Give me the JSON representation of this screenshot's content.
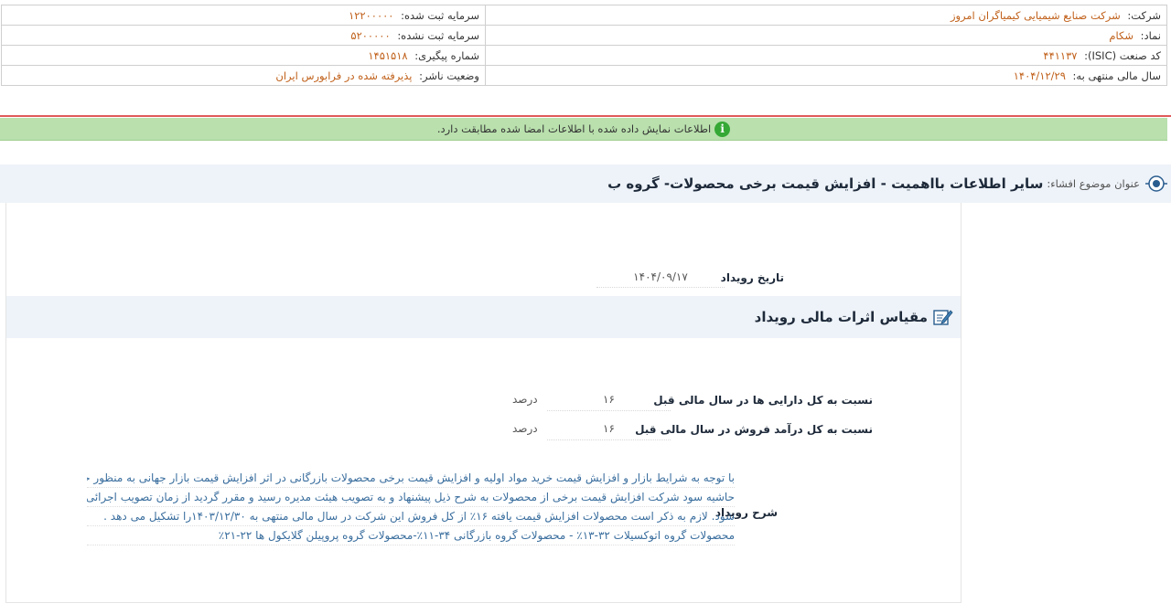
{
  "header": {
    "company_label": "شرکت:",
    "company_value": "شرکت صنایع شیمیایی کیمیاگران امروز",
    "registered_capital_label": "سرمایه ثبت شده:",
    "registered_capital_value": "۱۲۲۰۰۰۰۰",
    "symbol_label": "نماد:",
    "symbol_value": "شکام",
    "unregistered_capital_label": "سرمایه ثبت نشده:",
    "unregistered_capital_value": "۵۲۰۰۰۰۰",
    "isic_label": "کد صنعت (ISIC):",
    "isic_value": "۴۴۱۱۳۷",
    "tracking_label": "شماره پیگیری:",
    "tracking_value": "۱۴۵۱۵۱۸",
    "fiscal_year_label": "سال مالی منتهی به:",
    "fiscal_year_value": "۱۴۰۴/۱۲/۲۹",
    "publisher_status_label": "وضعیت ناشر:",
    "publisher_status_value": "پذیرفته شده در فرابورس ایران"
  },
  "notice": {
    "icon": "info-icon",
    "text": "اطلاعات نمایش داده شده با اطلاعات امضا شده مطابقت دارد."
  },
  "subject": {
    "label": "عنوان موضوع افشاء:",
    "title": "سایر اطلاعات بااهمیت - افزایش قیمت برخی محصولات- گروه ب"
  },
  "event": {
    "date_label": "تاریخ رویداد",
    "date_value": "۱۴۰۴/۰۹/۱۷"
  },
  "financial_section": {
    "title": "مقیاس اثرات مالی رویداد",
    "rows": [
      {
        "label": "نسبت به کل دارایی ها در سال مالی قبل",
        "value": "۱۶",
        "unit": "درصد"
      },
      {
        "label": "نسبت به کل درآمد فروش در سال مالی قبل",
        "value": "۱۶",
        "unit": "درصد"
      }
    ]
  },
  "description": {
    "label": "شرح رویداد",
    "lines": [
      "با توجه به شرایط بازار و افزایش قیمت خرید مواد اولیه و افزایش قیمت برخی محصولات بازرگانی در اثر افزایش قیمت بازار جهانی به منظور حفظ",
      "حاشیه سود شرکت افزایش قیمت برخی از محصولات به شرح ذیل پیشنهاد و به تصویب هیئت مدیره رسید و مقرر گردید از زمان تصویب اجرائی",
      "شود. لازم به ذکر است محصولات افزایش قیمت یافته ۱۶٪ از کل فروش این شرکت در سال مالی منتهی به ۱۴۰۳/۱۲/۳۰را تشکیل می دهد .",
      "محصولات گروه اتوکسیلات ۳۲-۱۳٪ - محصولات گروه بازرگانی ۳۴-۱۱٪-محصولات گروه پروپیلن گلایکول ها ۲۲-۲۱٪"
    ]
  },
  "colors": {
    "accent_value": "#c0601a",
    "notice_bg": "#b9e0ad",
    "description_text": "#3a6e9e",
    "red_separator": "#e05a5a"
  }
}
